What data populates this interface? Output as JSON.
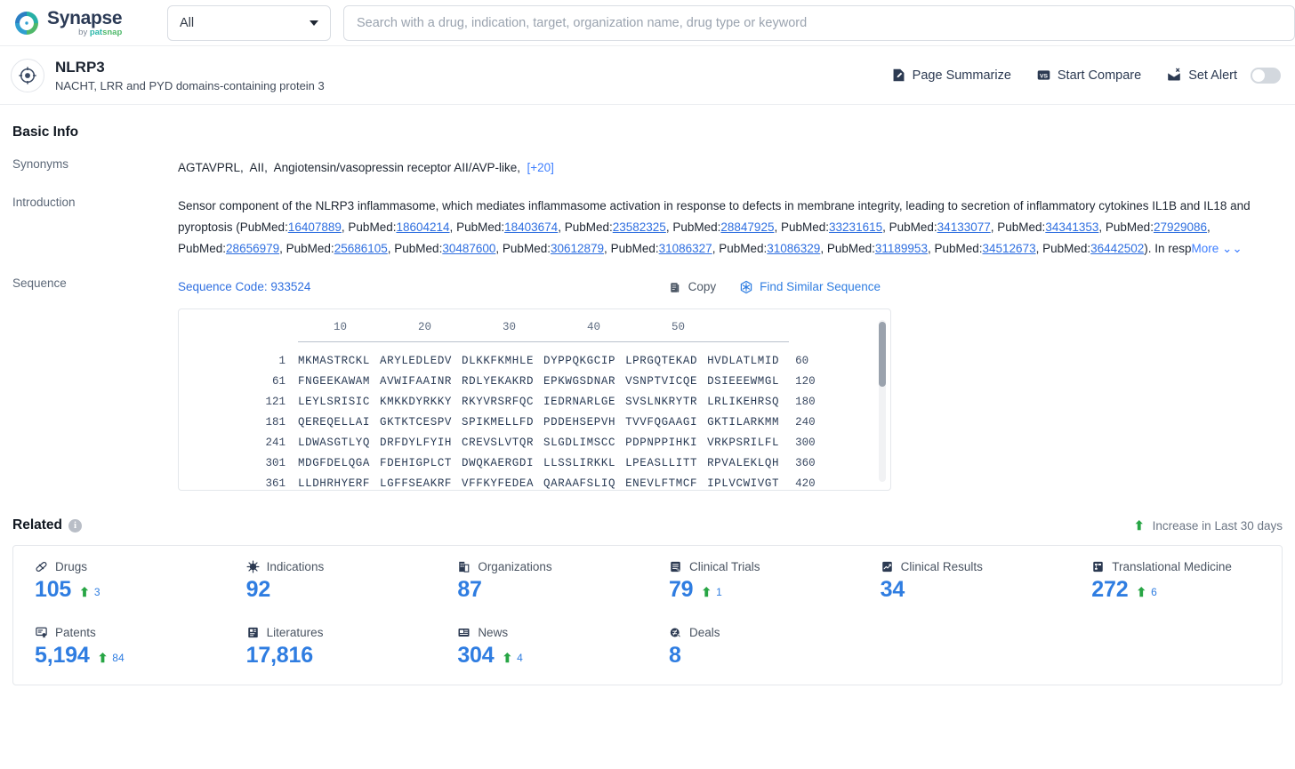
{
  "topbar": {
    "logo_name": "Synapse",
    "logo_sub_by": "by ",
    "logo_sub_pat": "pat",
    "logo_sub_snap": "snap",
    "scope_value": "All",
    "search_placeholder": "Search with a drug, indication, target, organization name, drug type or keyword",
    "search_value": ""
  },
  "entity": {
    "name": "NLRP3",
    "description": "NACHT, LRR and PYD domains-containing protein 3",
    "actions": [
      {
        "label": "Page Summarize",
        "icon": "page-summarize-icon"
      },
      {
        "label": "Start Compare",
        "icon": "versus-icon"
      },
      {
        "label": "Set Alert",
        "icon": "alert-bell-icon"
      }
    ]
  },
  "basic_info": {
    "title": "Basic Info",
    "synonyms_label": "Synonyms",
    "synonyms": [
      "AGTAVPRL",
      "AII",
      "Angiotensin/vasopressin receptor AII/AVP-like"
    ],
    "synonyms_more": "[+20]",
    "introduction_label": "Introduction",
    "introduction_prefix": "Sensor component of the NLRP3 inflammasome, which mediates inflammasome activation in response to defects in membrane integrity, leading to secretion of inflammatory cytokines IL1B and IL18 and pyroptosis (",
    "pubmed_prefix": "PubMed:",
    "pubmed_ids": [
      "16407889",
      "18604214",
      "18403674",
      "23582325",
      "28847925",
      "33231615",
      "34133077",
      "34341353",
      "27929086",
      "28656979",
      "25686105",
      "30487600",
      "30612879",
      "31086327",
      "31086329",
      "31189953",
      "34512673",
      "36442502"
    ],
    "introduction_suffix": "). In resp",
    "more_label": "More"
  },
  "sequence": {
    "label": "Sequence",
    "code_label": "Sequence Code: 933524",
    "copy_label": "Copy",
    "find_similar_label": "Find Similar Sequence",
    "ruler_ticks": [
      "10",
      "20",
      "30",
      "40",
      "50"
    ],
    "rows": [
      {
        "start": "1",
        "chunks": [
          "MKMASTRCKL",
          "ARYLEDLEDV",
          "DLKKFKMHLE",
          "DYPPQKGCIP",
          "LPRGQTEKAD",
          "HVDLATLMID"
        ],
        "end": "60"
      },
      {
        "start": "61",
        "chunks": [
          "FNGEEKAWAM",
          "AVWIFAAINR",
          "RDLYEKAKRD",
          "EPKWGSDNAR",
          "VSNPTVICQE",
          "DSIEEEWMGL"
        ],
        "end": "120"
      },
      {
        "start": "121",
        "chunks": [
          "LEYLSRISIC",
          "KMKKDYRKKY",
          "RKYVRSRFQC",
          "IEDRNARLGE",
          "SVSLNKRYTR",
          "LRLIKEHRSQ"
        ],
        "end": "180"
      },
      {
        "start": "181",
        "chunks": [
          "QEREQELLAI",
          "GKTKTCESPV",
          "SPIKMELLFD",
          "PDDEHSEPVH",
          "TVVFQGAAGI",
          "GKTILARKMM"
        ],
        "end": "240"
      },
      {
        "start": "241",
        "chunks": [
          "LDWASGTLYQ",
          "DRFDYLFYIH",
          "CREVSLVTQR",
          "SLGDLIMSCC",
          "PDPNPPIHKI",
          "VRKPSRILFL"
        ],
        "end": "300"
      },
      {
        "start": "301",
        "chunks": [
          "MDGFDELQGA",
          "FDEHIGPLCT",
          "DWQKAERGDI",
          "LLSSLIRKKL",
          "LPEASLLITT",
          "RPVALEKLQH"
        ],
        "end": "360"
      },
      {
        "start": "361",
        "chunks": [
          "LLDHRHYERF",
          "LGFFSEAKRF",
          "VFFKYFEDEA",
          "QARAAFSLIQ",
          "ENEVLFTMCF",
          "IPLVCWIVGT"
        ],
        "end": "420"
      }
    ]
  },
  "related": {
    "title": "Related",
    "legend": "Increase in Last 30 days",
    "items": [
      {
        "label": "Drugs",
        "icon": "pill-icon",
        "value": "105",
        "delta": "3"
      },
      {
        "label": "Indications",
        "icon": "virus-icon",
        "value": "92",
        "delta": ""
      },
      {
        "label": "Organizations",
        "icon": "building-icon",
        "value": "87",
        "delta": ""
      },
      {
        "label": "Clinical Trials",
        "icon": "clipboard-icon",
        "value": "79",
        "delta": "1"
      },
      {
        "label": "Clinical Results",
        "icon": "chart-doc-icon",
        "value": "34",
        "delta": ""
      },
      {
        "label": "Translational Medicine",
        "icon": "flow-doc-icon",
        "value": "272",
        "delta": "6"
      },
      {
        "label": "Patents",
        "icon": "patent-icon",
        "value": "5,194",
        "delta": "84"
      },
      {
        "label": "Literatures",
        "icon": "book-icon",
        "value": "17,816",
        "delta": ""
      },
      {
        "label": "News",
        "icon": "news-icon",
        "value": "304",
        "delta": "4"
      },
      {
        "label": "Deals",
        "icon": "deal-icon",
        "value": "8",
        "delta": ""
      }
    ]
  },
  "colors": {
    "accent_blue": "#2f7de1",
    "link_blue": "#3d7eff",
    "increase_green": "#27a544",
    "icon_navy": "#2c3a52"
  }
}
